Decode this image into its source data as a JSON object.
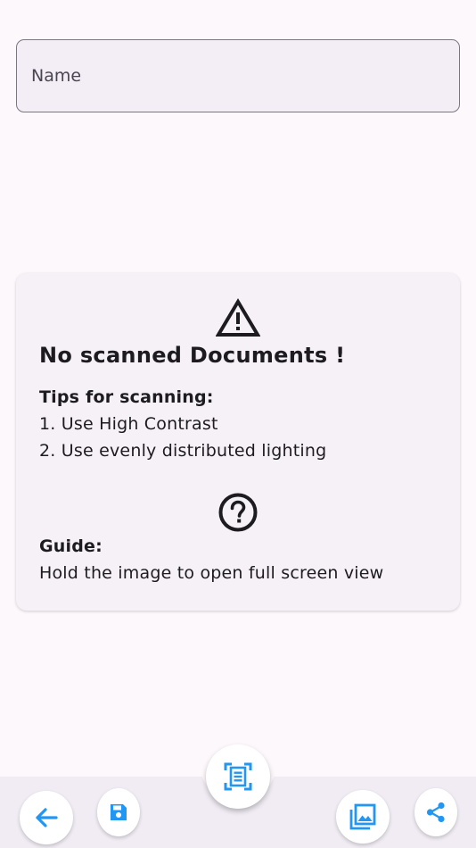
{
  "name_field": {
    "placeholder": "Name",
    "value": ""
  },
  "empty_state": {
    "title": "No scanned Documents !",
    "tips_heading": "Tips for scanning:",
    "tips": [
      "1. Use High Contrast",
      "2. Use evenly distributed lighting"
    ],
    "guide_heading": "Guide:",
    "guide_text": "Hold the image to open full screen view"
  },
  "icons": {
    "warning": "warning-triangle-icon",
    "help": "help-circle-icon",
    "back": "arrow-back-icon",
    "save": "save-floppy-icon",
    "scan": "document-scanner-icon",
    "gallery": "photo-library-icon",
    "share": "share-icon"
  },
  "colors": {
    "accent": "#2196f3",
    "text": "#1d1b20",
    "card_bg": "#f5f1f7",
    "bar_bg": "#f1ecf4"
  }
}
